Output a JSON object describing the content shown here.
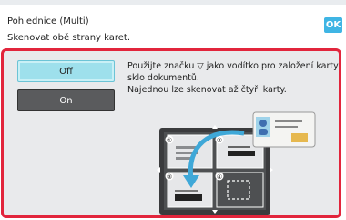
{
  "header": {
    "title": "Pohlednice (Multi)",
    "subtitle": "Skenovat obě strany karet.",
    "ok_label": "OK"
  },
  "options": [
    {
      "label": "Off",
      "selected": true
    },
    {
      "label": "On",
      "selected": false
    }
  ],
  "instructions": [
    "Použijte značku ▽ jako vodítko pro založení karty na",
    "sklo dokumentů.",
    "Najednou lze skenovat až čtyři karty."
  ],
  "illustration": {
    "slot_numbers": [
      "①",
      "②",
      "③",
      "④"
    ]
  },
  "colors": {
    "accent": "#3fb5e4",
    "panel_border": "#e2253c",
    "selected_button": "#9ee0ec",
    "unselected_button": "#5a5b5d"
  }
}
